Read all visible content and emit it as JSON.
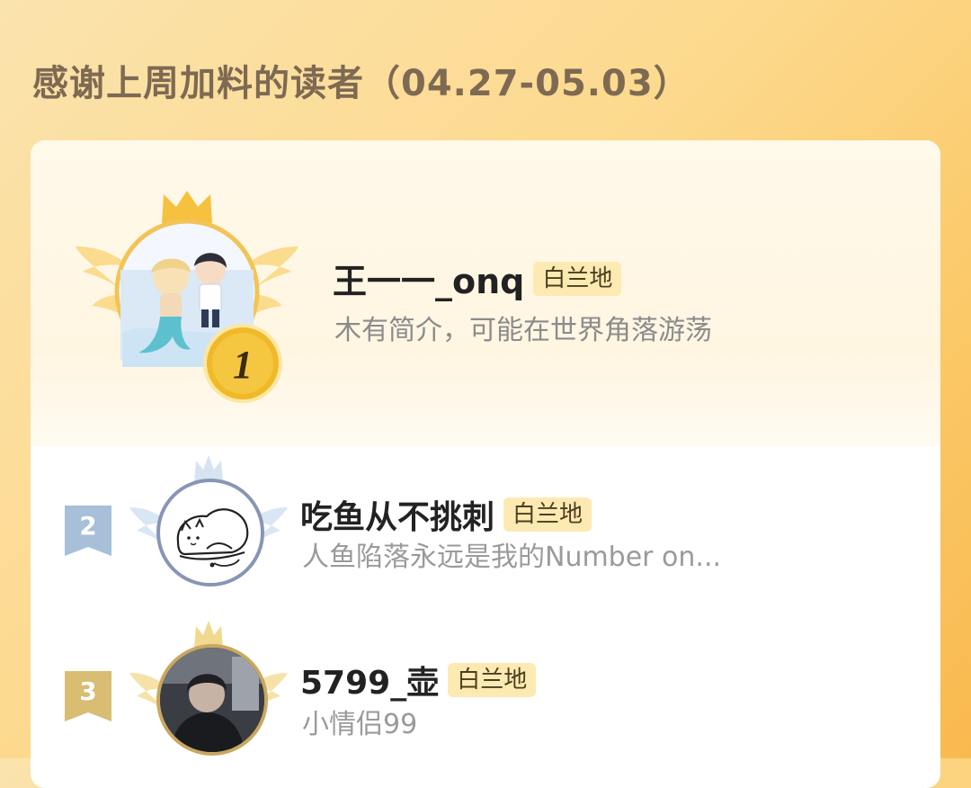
{
  "header": {
    "title": "感谢上周加料的读者（04.27-05.03）"
  },
  "leaderboard": [
    {
      "rank": "1",
      "name": "王一一_onq",
      "badge": "白兰地",
      "bio": "木有简介，可能在世界角落游荡",
      "tier": "gold"
    },
    {
      "rank": "2",
      "name": "吃鱼从不挑刺",
      "badge": "白兰地",
      "bio": "人鱼陷落永远是我的Number on...",
      "tier": "silver"
    },
    {
      "rank": "3",
      "name": "5799_壶",
      "badge": "白兰地",
      "bio": "小情侣99",
      "tier": "bronze"
    }
  ],
  "colors": {
    "gold": "#e8b63d",
    "silver": "#a8bdd6",
    "bronze": "#d4b66a",
    "badge_bg": "#fdeab2"
  }
}
